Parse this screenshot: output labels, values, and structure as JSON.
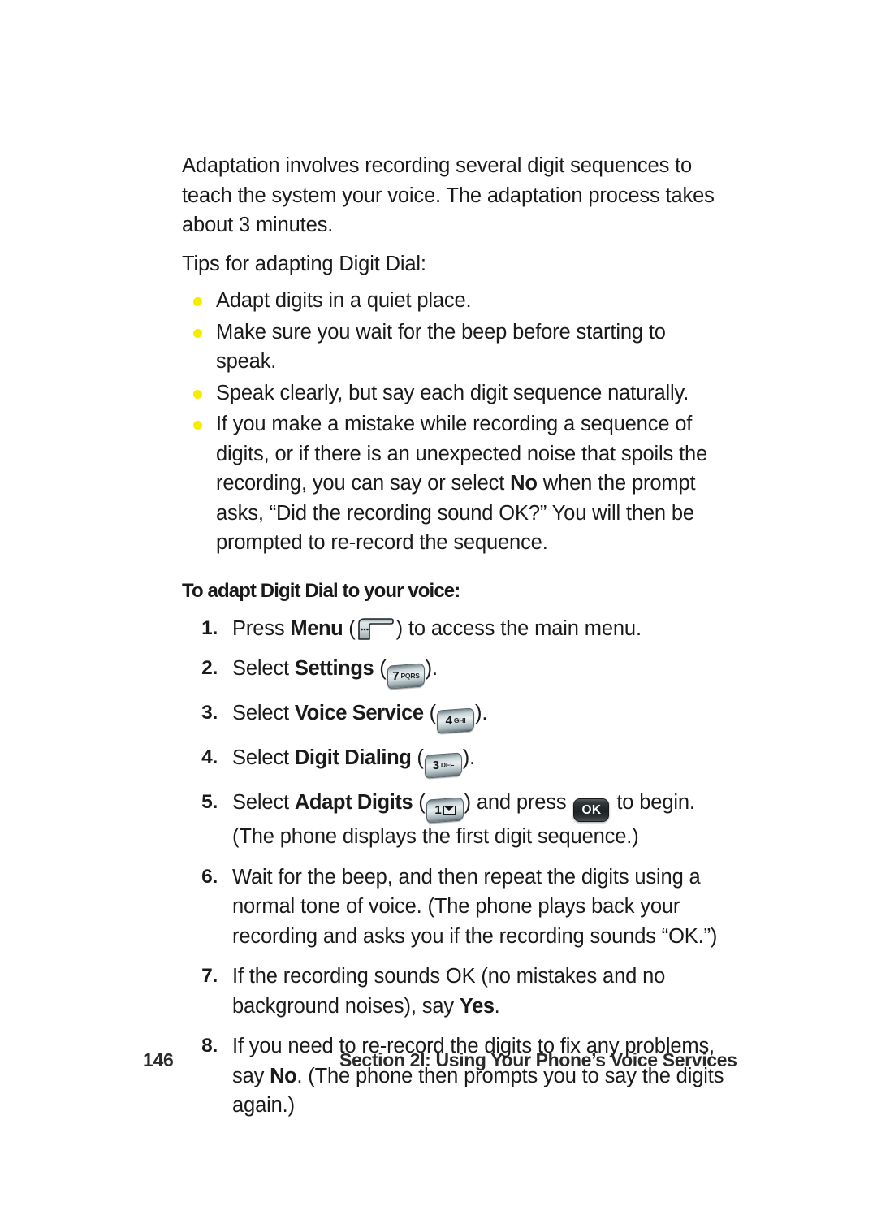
{
  "page": {
    "background_color": "#ffffff",
    "text_color": "#1a1a1a",
    "bullet_color": "#f5ec00"
  },
  "intro": {
    "paragraph": "Adaptation involves recording several digit sequences to teach the system your voice. The adaptation process takes about 3 minutes.",
    "tips_lead": "Tips for adapting Digit Dial:"
  },
  "tips": [
    {
      "text": "Adapt digits in a quiet place."
    },
    {
      "text": "Make sure you wait for the beep before starting to speak."
    },
    {
      "text": "Speak clearly, but say each digit sequence naturally."
    },
    {
      "prefix": "If you make a mistake while recording a sequence of digits, or if there is an unexpected noise that spoils the recording, you can say or select ",
      "bold": "No",
      "suffix": " when the prompt asks, “Did the recording sound OK?” You will then be prompted to re-record the sequence."
    }
  ],
  "procedure": {
    "heading": "To adapt Digit Dial to your voice:",
    "steps": [
      {
        "number": "1.",
        "pre": "Press ",
        "bold": "Menu",
        "open_paren": " (",
        "icon": "menu-softkey-icon",
        "close_paren": ")",
        "post": " to access the main menu."
      },
      {
        "number": "2.",
        "pre": "Select ",
        "bold": "Settings",
        "open_paren": " (",
        "icon": "keypad-7-pqrs-icon",
        "key_digit": "7",
        "key_letters": "PQRS",
        "close_paren": ")",
        "post": "."
      },
      {
        "number": "3.",
        "pre": "Select ",
        "bold": "Voice Service",
        "open_paren": " (",
        "icon": "keypad-4-ghi-icon",
        "key_digit": "4",
        "key_letters": "GHI",
        "close_paren": ")",
        "post": "."
      },
      {
        "number": "4.",
        "pre": "Select ",
        "bold": "Digit Dialing",
        "open_paren": " (",
        "icon": "keypad-3-def-icon",
        "key_digit": "3",
        "key_letters": "DEF",
        "close_paren": ")",
        "post": "."
      },
      {
        "number": "5.",
        "pre": "Select ",
        "bold": "Adapt Digits",
        "open_paren": " (",
        "icon": "keypad-1-envelope-icon",
        "key_digit": "1",
        "key_letters": "",
        "close_paren": ")",
        "mid": " and press ",
        "ok_label": "OK",
        "post": " to begin. (The phone displays the first digit sequence.)"
      },
      {
        "number": "6.",
        "text": "Wait for the beep, and then repeat the digits using a normal tone of voice. (The phone plays back your recording and asks you if the recording sounds “OK.”)"
      },
      {
        "number": "7.",
        "pre": "If the recording sounds OK (no mistakes and no background noises), say ",
        "bold": "Yes",
        "post": "."
      },
      {
        "number": "8.",
        "pre": "If you need to re-record the digits to fix any problems, say ",
        "bold": "No",
        "post": ". (The phone then prompts you to say the digits again.)"
      }
    ]
  },
  "footer": {
    "page_number": "146",
    "section_title": "Section 2I: Using Your Phone’s Voice Services"
  }
}
